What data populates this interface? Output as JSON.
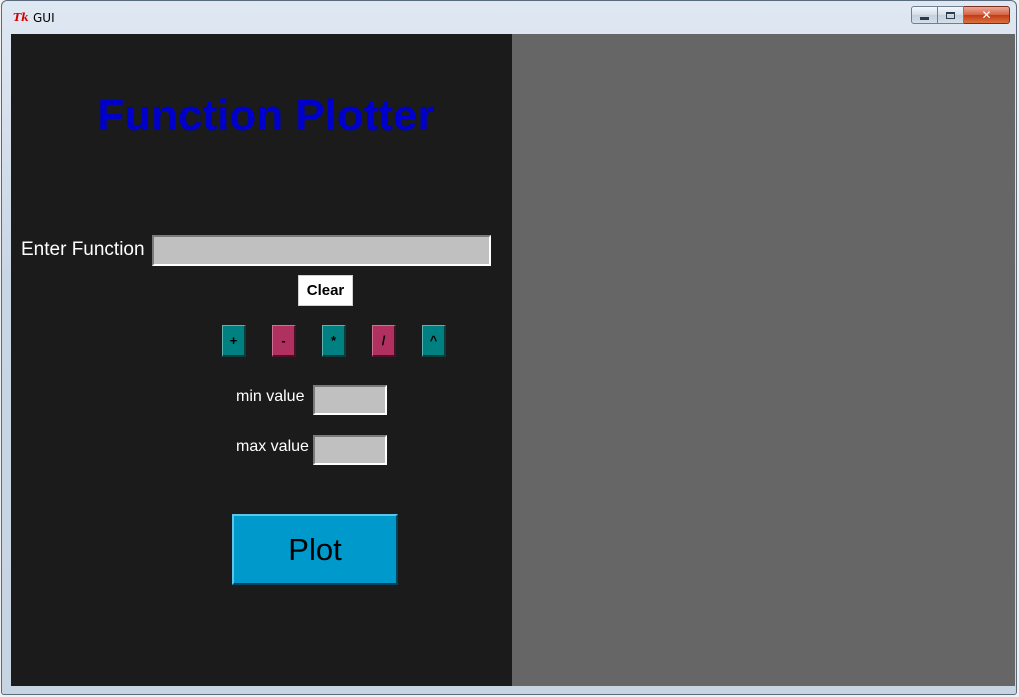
{
  "window": {
    "title": "GUI",
    "app_icon": "tk-feather-icon",
    "minimize_label": "",
    "maximize_label": "",
    "close_label": "✕"
  },
  "panel": {
    "title": "Function Plotter",
    "title_color": "#0000cc",
    "background": "#1b1b1b",
    "function_label": "Enter Function",
    "function_value": "",
    "clear_label": "Clear",
    "operators": [
      {
        "symbol": "+",
        "color": "#008080"
      },
      {
        "symbol": "-",
        "color": "#b03060"
      },
      {
        "symbol": "*",
        "color": "#008080"
      },
      {
        "symbol": "/",
        "color": "#b03060"
      },
      {
        "symbol": "^",
        "color": "#008080"
      }
    ],
    "min_label": "min value",
    "min_value": "",
    "max_label": "max value",
    "max_value": "",
    "plot_label": "Plot",
    "plot_color": "#0099cc"
  },
  "plot_area": {
    "background": "#666666"
  }
}
